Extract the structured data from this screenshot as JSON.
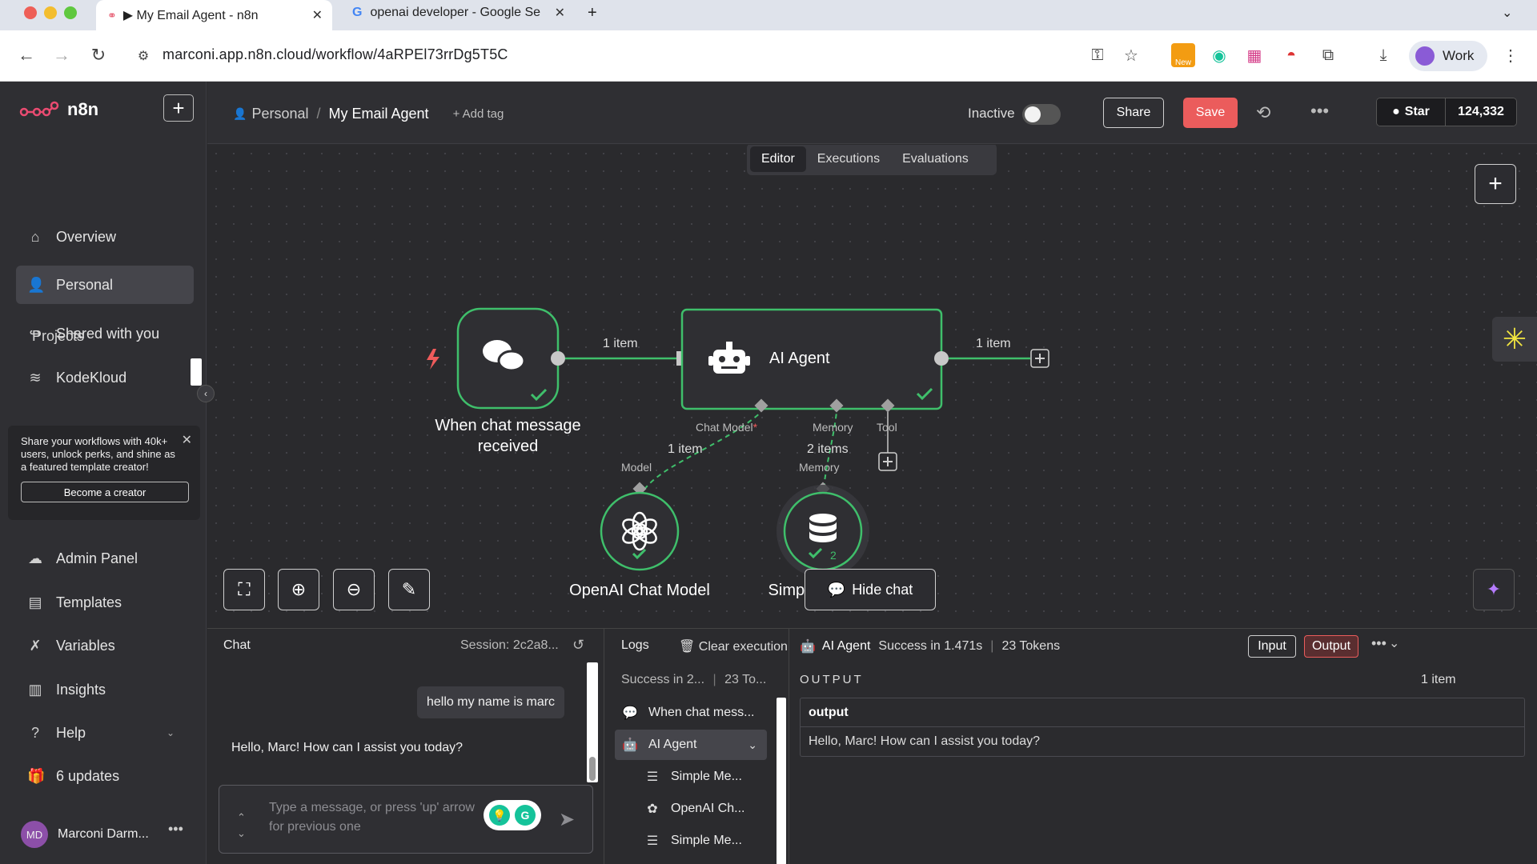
{
  "browser": {
    "tabs": [
      {
        "title": "▶ My Email Agent - n8n"
      },
      {
        "title": "openai developer - Google Se"
      }
    ],
    "url": "marconi.app.n8n.cloud/workflow/4aRPEl73rrDg5T5C",
    "profile_label": "Work",
    "new_badge": "New"
  },
  "sidebar": {
    "brand": "n8n",
    "nav": [
      {
        "label": "Overview",
        "icon": "home-icon"
      },
      {
        "label": "Personal",
        "icon": "user-icon"
      },
      {
        "label": "Shared with you",
        "icon": "share-icon"
      }
    ],
    "projects_label": "Projects",
    "project": "KodeKloud",
    "promo": {
      "text": "Share your workflows with 40k+ users, unlock perks, and shine as a featured template creator!",
      "button": "Become a creator"
    },
    "bottom_nav": [
      {
        "label": "Admin Panel",
        "icon": "cloud-icon"
      },
      {
        "label": "Templates",
        "icon": "templates-icon"
      },
      {
        "label": "Variables",
        "icon": "variables-icon"
      },
      {
        "label": "Insights",
        "icon": "chart-icon"
      },
      {
        "label": "Help",
        "icon": "help-icon"
      },
      {
        "label": "6 updates",
        "icon": "gift-icon"
      }
    ],
    "user": {
      "initials": "MD",
      "name": "Marconi Darm..."
    }
  },
  "header": {
    "breadcrumb_owner": "Personal",
    "workflow_name": "My Email Agent",
    "add_tag": "+ Add tag",
    "status_label": "Inactive",
    "share": "Share",
    "save": "Save",
    "star": "Star",
    "star_count": "124,332"
  },
  "canvas": {
    "view_tabs": [
      "Editor",
      "Executions",
      "Evaluations"
    ],
    "nodes": {
      "trigger": "When chat message received",
      "agent": "AI Agent",
      "model": "OpenAI Chat Model",
      "memory": "Simple Memory",
      "memory_badge": "2"
    },
    "edges": {
      "trigger_to_agent": "1 item",
      "agent_out": "1 item",
      "model_items": "1 item",
      "memory_items": "2 items"
    },
    "ports": {
      "chat_model": "Chat Model",
      "chat_model_required": "*",
      "memory": "Memory",
      "tool": "Tool",
      "model": "Model",
      "memory_in": "Memory"
    },
    "hide_chat": "Hide chat"
  },
  "chat": {
    "title": "Chat",
    "session": "Session: 2c2a8...",
    "user_message": "hello my name is marc",
    "bot_message": "Hello, Marc! How can I assist you today?",
    "placeholder": "Type a message, or press 'up' arrow for previous one"
  },
  "logs": {
    "title": "Logs",
    "clear": "Clear execution",
    "summary_status": "Success in 2...",
    "summary_tokens": "23 To...",
    "items": [
      {
        "label": "When chat mess...",
        "icon": "chat-icon"
      },
      {
        "label": "AI Agent",
        "icon": "robot-icon"
      },
      {
        "label": "Simple Me...",
        "icon": "database-icon"
      },
      {
        "label": "OpenAI Ch...",
        "icon": "openai-icon"
      },
      {
        "label": "Simple Me...",
        "icon": "database-icon"
      }
    ]
  },
  "output": {
    "node": "AI Agent",
    "status": "Success in 1.471s",
    "tokens": "23 Tokens",
    "input_btn": "Input",
    "output_btn": "Output",
    "section_label": "OUTPUT",
    "item_count": "1 item",
    "column": "output",
    "value": "Hello, Marc! How can I assist you today?"
  },
  "colors": {
    "accent": "#eb5c5c",
    "success": "#3fbf6b",
    "canvas_bg": "#2a2a2d"
  }
}
